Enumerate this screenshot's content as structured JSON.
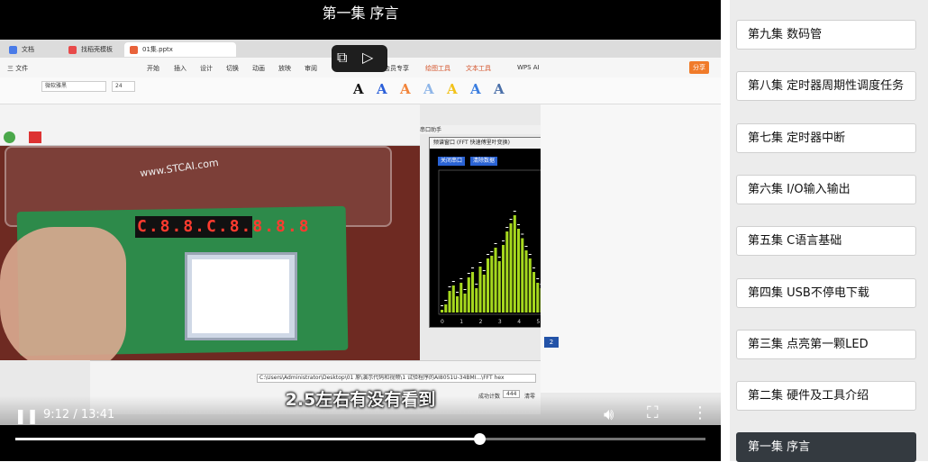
{
  "video": {
    "title": "第一集 序言",
    "subtitle": "2.5左右有没有看到",
    "current_time": "9:12",
    "duration": "13:41",
    "progress": 0.672
  },
  "screen": {
    "tabs": [
      "文档",
      "找稻壳模板",
      "01集.pptx"
    ],
    "menu": [
      "三 文件",
      "开始",
      "插入",
      "设计",
      "切换",
      "动画",
      "放映",
      "审阅",
      "会员专享",
      "绘图工具",
      "文本工具",
      "WPS AI"
    ],
    "font_name": "微软雅黑",
    "font_size": "24",
    "share_label": "分享",
    "serial_title": "串口助手",
    "fft_window_title": "频谱窗口 (FFT 快速傅里叶变换)",
    "fft_buttons": [
      "关闭串口",
      "清除数据",
      "设置",
      "帮助"
    ],
    "fft_x_labels": [
      "0",
      "1",
      "2",
      "3",
      "4",
      "5",
      "6",
      "7",
      "8",
      "9",
      "10",
      "11",
      "(KHz)"
    ],
    "watermark": "www.STCAI.com",
    "digits": "C.8.8.C.8.8.8.8",
    "path_text": "C:\\Users\\Administrator\\Desktop\\01 原\\演示代码和视频\\1 试验程序的AI8051U-34BMI...\\FFT hex",
    "count_label": "成功计数",
    "count_value": "444",
    "clear_label": "清零",
    "cpu_label": "CPU-Test",
    "side_label": "8\b"
  },
  "playlist": [
    {
      "label": "第九集 数码管",
      "active": false
    },
    {
      "label": "第八集 定时器周期性调度任务",
      "active": false
    },
    {
      "label": "第七集 定时器中断",
      "active": false
    },
    {
      "label": "第六集 I/O输入输出",
      "active": false
    },
    {
      "label": "第五集 C语言基础",
      "active": false
    },
    {
      "label": "第四集 USB不停电下载",
      "active": false
    },
    {
      "label": "第三集 点亮第一颗LED",
      "active": false
    },
    {
      "label": "第二集 硬件及工具介绍",
      "active": false
    },
    {
      "label": "第一集 序言",
      "active": true
    }
  ],
  "colors": {
    "spectrum_bar": "#a6d81e",
    "spectrum_peak": "#ffffff",
    "playlist_active": "#343a40",
    "fft_button": "#2a63d4"
  },
  "spectrum": [
    0.02,
    0.06,
    0.16,
    0.2,
    0.12,
    0.22,
    0.14,
    0.26,
    0.3,
    0.18,
    0.34,
    0.28,
    0.4,
    0.42,
    0.48,
    0.38,
    0.5,
    0.6,
    0.66,
    0.72,
    0.62,
    0.55,
    0.46,
    0.4,
    0.3,
    0.22,
    0.18,
    0.12,
    0.3,
    0.26,
    0.18,
    0.34,
    0.28,
    0.22,
    0.18,
    0.14,
    0.1,
    0.08,
    0.14,
    0.12,
    0.08,
    0.06,
    0.05,
    0.08,
    0.06,
    0.04,
    0.03,
    0.04,
    0.02,
    0.02,
    0.01,
    0.02,
    0.01,
    0.01,
    0.02,
    0.01,
    0.01,
    0.01,
    0.01,
    0.01
  ]
}
